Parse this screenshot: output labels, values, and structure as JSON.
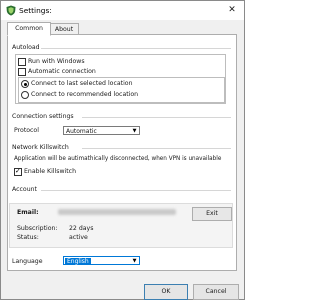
{
  "window": {
    "title": "Settings:"
  },
  "tabs": [
    {
      "label": "Common"
    },
    {
      "label": "About"
    }
  ],
  "autoload": {
    "heading": "Autoload",
    "run_with_windows": {
      "label": "Run with Windows",
      "checked": false
    },
    "automatic_connection": {
      "label": "Automatic connection",
      "checked": false
    },
    "connect_last": {
      "label": "Connect to last selected location",
      "selected": true
    },
    "connect_recommended": {
      "label": "Connect to recommended location",
      "selected": false
    }
  },
  "connection": {
    "heading": "Connection settings",
    "protocol_label": "Protocol",
    "protocol_value": "Automatic"
  },
  "killswitch": {
    "heading": "Network Killswitch",
    "description": "Application will be autimathically disconnected, when VPN is unavailable",
    "enable_label": "Enable Killswitch",
    "enabled": true
  },
  "account": {
    "heading": "Account",
    "email_label": "Email:",
    "exit_label": "Exit",
    "subscription_label": "Subscription:",
    "subscription_value": "22 days",
    "status_label": "Status:",
    "status_value": "active"
  },
  "language": {
    "label": "Language",
    "value": "English"
  },
  "footer": {
    "ok_label": "OK",
    "cancel_label": "Cancel"
  },
  "colors": {
    "accent": "#0078d7",
    "app_icon": "#2a6e2f",
    "ok_border": "#3c7fb1"
  }
}
